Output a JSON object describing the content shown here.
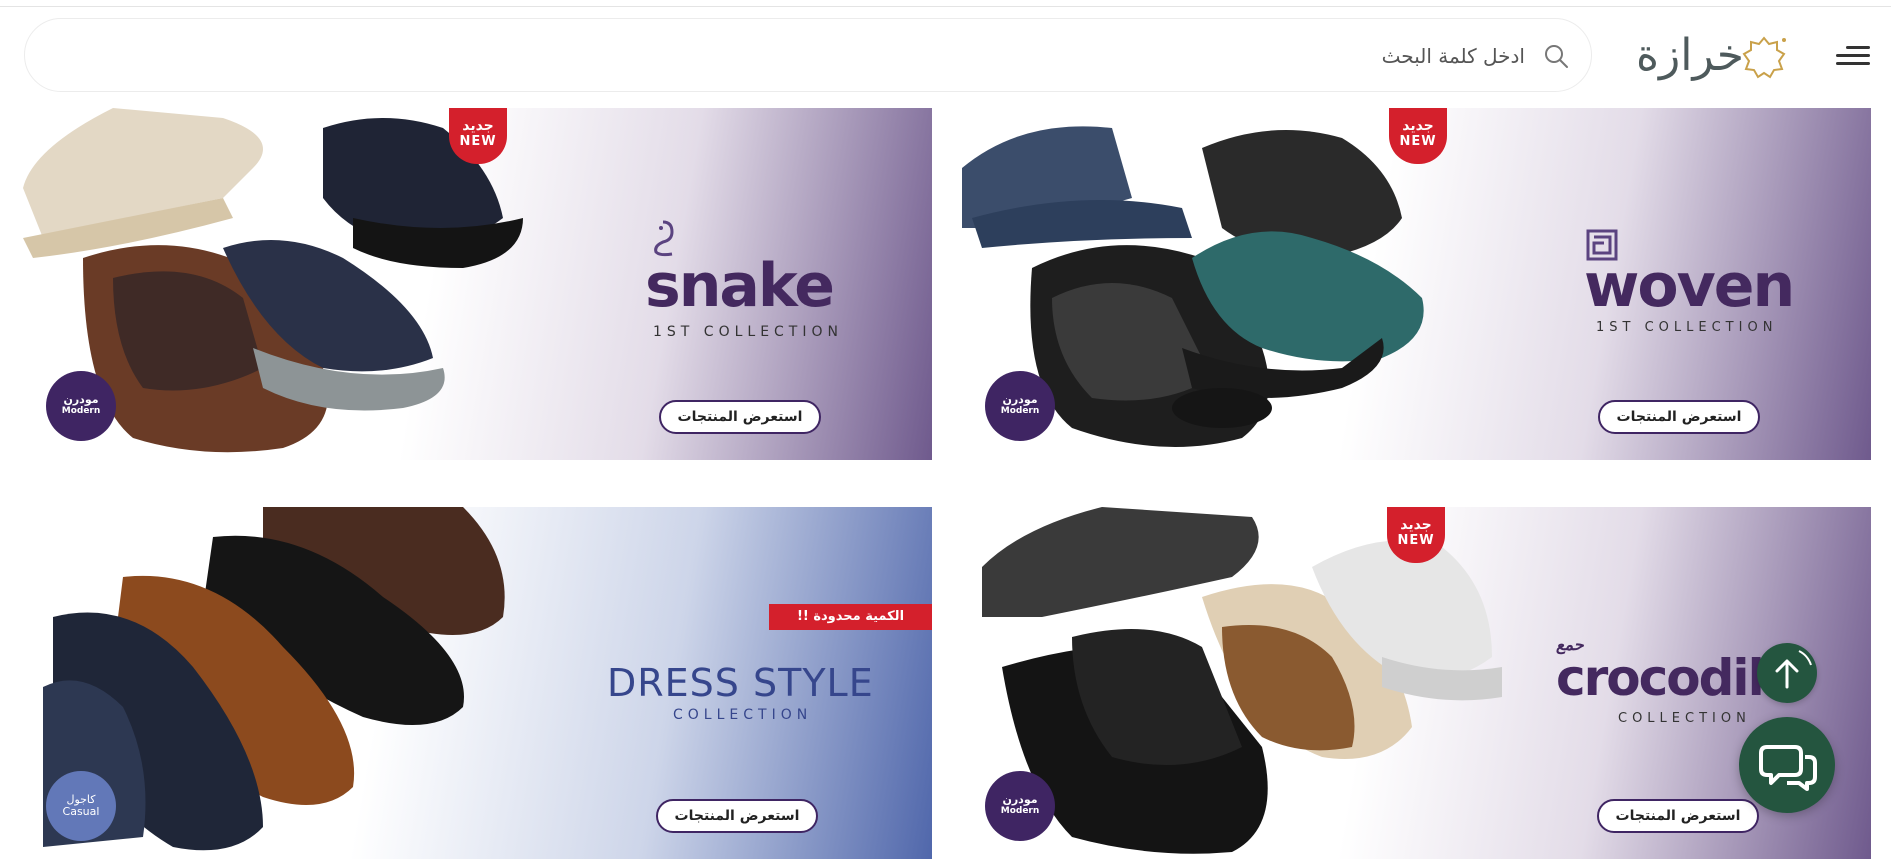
{
  "header": {
    "search": {
      "placeholder": "ادخل كلمة البحث",
      "value": ""
    },
    "logo_text": "خرازة",
    "icons": {
      "search": "search-icon",
      "menu": "hamburger-menu-icon",
      "logo": "star-seal-icon"
    }
  },
  "colors": {
    "brand_purple": "#3f2563",
    "new_red": "#d4202c",
    "chat_green": "#24553f",
    "casual_blue": "#6278b8"
  },
  "banners": [
    {
      "new_tag_ar": "جديد",
      "new_tag_en": "NEW",
      "title": "woven",
      "subtitle": "1ST COLLECTION",
      "badge_ar": "مودرن",
      "badge_en": "Modern",
      "cta": "استعرض المنتجات"
    },
    {
      "new_tag_ar": "جديد",
      "new_tag_en": "NEW",
      "title": "snake",
      "subtitle": "1ST COLLECTION",
      "badge_ar": "مودرن",
      "badge_en": "Modern",
      "cta": "استعرض المنتجات"
    },
    {
      "new_tag_ar": "جديد",
      "new_tag_en": "NEW",
      "title": "crocodil",
      "title_prefix_ar": "حمع",
      "subtitle": "COLLECTION",
      "badge_ar": "مودرن",
      "badge_en": "Modern",
      "cta": "استعرض المنتجات"
    },
    {
      "limited_tag": "الكمية محدودة !!",
      "title": "DRESS STYLE",
      "subtitle": "COLLECTION",
      "badge_ar": "كاجول",
      "badge_en": "Casual",
      "cta": "استعرض المنتجات"
    }
  ],
  "floating": {
    "scroll_top_icon": "arrow-up-icon",
    "chat_icon": "chat-bubbles-icon"
  }
}
